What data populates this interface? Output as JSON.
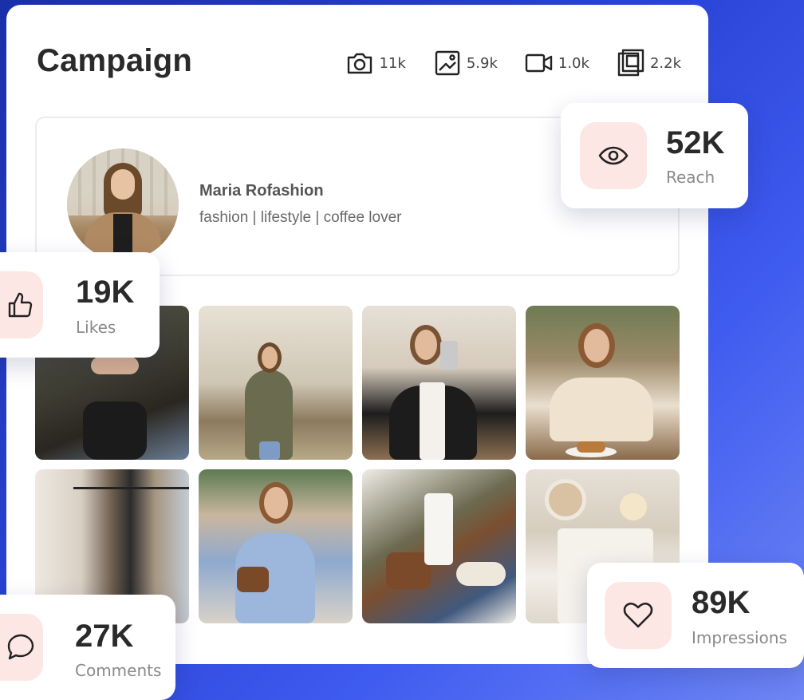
{
  "campaign": {
    "title": "Campaign",
    "stats": [
      {
        "icon": "camera-icon",
        "value": "11k"
      },
      {
        "icon": "image-icon",
        "value": "5.9k"
      },
      {
        "icon": "video-icon",
        "value": "1.0k"
      },
      {
        "icon": "gallery-stack-icon",
        "value": "2.2k"
      }
    ]
  },
  "profile": {
    "name": "Maria Rofashion",
    "bio": "fashion | lifestyle | coffee lover"
  },
  "metrics": {
    "reach": {
      "value": "52K",
      "label": "Reach",
      "icon": "eye-icon"
    },
    "likes": {
      "value": "19K",
      "label": "Likes",
      "icon": "thumbs-up-icon"
    },
    "comments": {
      "value": "27K",
      "label": "Comments",
      "icon": "chat-bubble-icon"
    },
    "impressions": {
      "value": "89K",
      "label": "Impressions",
      "icon": "heart-icon"
    }
  },
  "colors": {
    "background": "#2a44d6",
    "icon_tile": "#fde7e4",
    "text_dark": "#2a2a2a",
    "text_muted": "#8a8a8a"
  }
}
